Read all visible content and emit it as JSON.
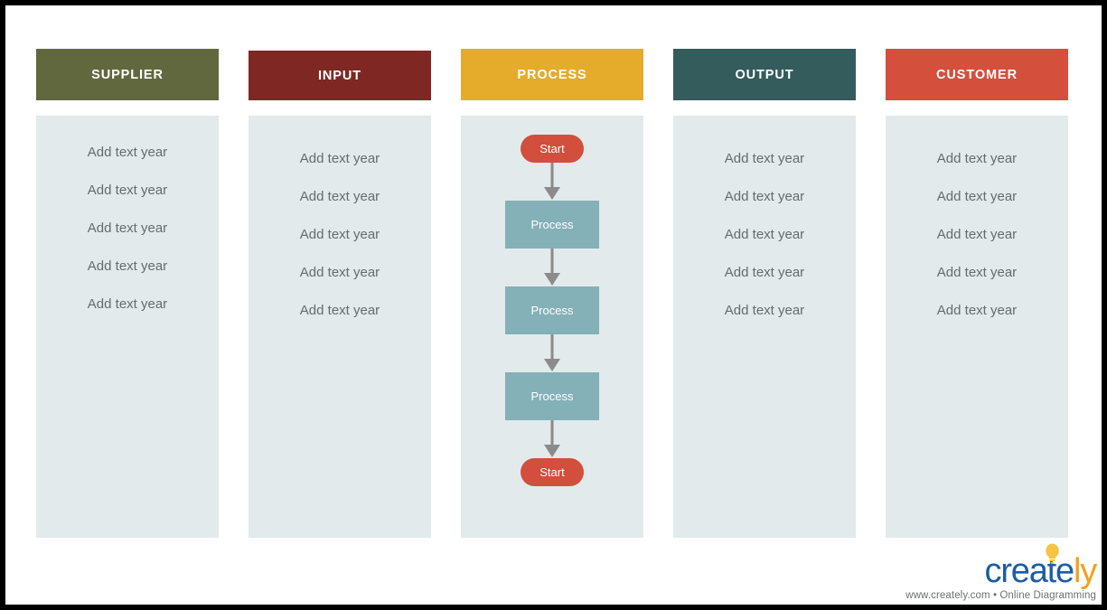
{
  "diagram": {
    "type": "SIPOC",
    "columns": [
      {
        "id": "supplier",
        "header": "SUPPLIER",
        "header_color": "#62683d",
        "body_color": "#e2eaeb",
        "items": [
          "Add text year",
          "Add text year",
          "Add text year",
          "Add text year",
          "Add text year"
        ]
      },
      {
        "id": "input",
        "header": "INPUT",
        "header_color": "#7f2722",
        "body_color": "#e2eaeb",
        "items": [
          "Add text year",
          "Add text year",
          "Add text year",
          "Add text year",
          "Add text year"
        ]
      },
      {
        "id": "process",
        "header": "PROCESS",
        "header_color": "#e5ab2b",
        "body_color": "#e2eaeb",
        "items": []
      },
      {
        "id": "output",
        "header": "OUTPUT",
        "header_color": "#345c5c",
        "body_color": "#e2eaeb",
        "items": [
          "Add text year",
          "Add text year",
          "Add text year",
          "Add text year",
          "Add text year"
        ]
      },
      {
        "id": "customer",
        "header": "CUSTOMER",
        "header_color": "#d44f3c",
        "body_color": "#e2eaeb",
        "items": [
          "Add text year",
          "Add text year",
          "Add text year",
          "Add text year",
          "Add text year"
        ]
      }
    ],
    "flow": {
      "nodes": [
        {
          "label": "Start",
          "shape": "terminator",
          "color": "#d24e3d"
        },
        {
          "label": "Process",
          "shape": "rectangle",
          "color": "#84b0b8"
        },
        {
          "label": "Process",
          "shape": "rectangle",
          "color": "#84b0b8"
        },
        {
          "label": "Process",
          "shape": "rectangle",
          "color": "#84b0b8"
        },
        {
          "label": "Start",
          "shape": "terminator",
          "color": "#d24e3d"
        }
      ],
      "connector_color": "#8b8b8b"
    }
  },
  "footer": {
    "logo_part_1": "create",
    "logo_part_2": "ly",
    "logo_color_1": "#1a5ca8",
    "logo_color_2": "#f3a01c",
    "tagline": "www.creately.com • Online Diagramming"
  }
}
